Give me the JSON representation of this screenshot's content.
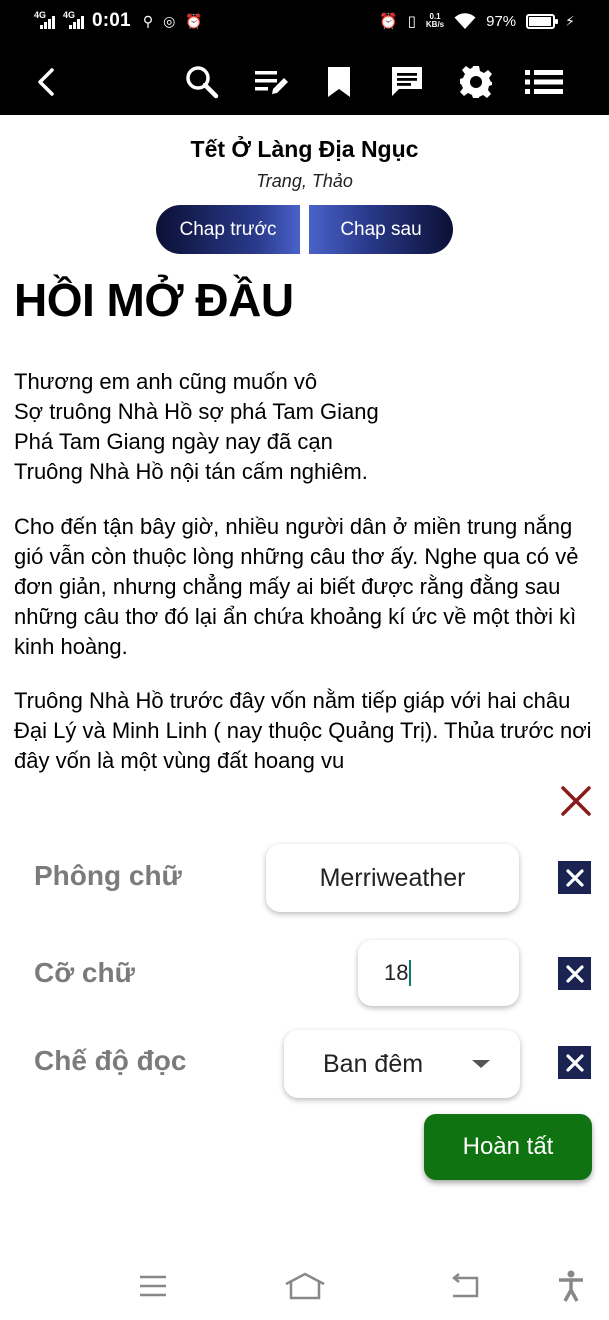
{
  "status_bar": {
    "network_1": "4G",
    "network_2": "4G",
    "time": "0:01",
    "speed_value": "0.1",
    "speed_unit": "KB/s",
    "battery": "97%",
    "battery_level": 0.97
  },
  "toolbar": {
    "icons": [
      "back-icon",
      "search-icon",
      "edit-list-icon",
      "bookmark-icon",
      "comment-icon",
      "gear-icon",
      "list-icon"
    ]
  },
  "book": {
    "title": "Tết Ở Làng Địa Ngục",
    "author": "Trang, Thảo",
    "prev_label": "Chap trước",
    "next_label": "Chap sau",
    "chapter_heading": "HỒI MỞ ĐẦU",
    "verse_lines": [
      "Thương em anh cũng muốn vô",
      "Sợ truông Nhà Hồ sợ phá Tam Giang",
      "Phá Tam Giang ngày nay đã cạn",
      "Truông Nhà Hồ nội tán cấm nghiêm."
    ],
    "paragraph_2": "Cho đến tận bây giờ, nhiều người dân ở miền trung nắng gió vẫn còn thuộc lòng những câu thơ ấy. Nghe qua có vẻ đơn giản, nhưng chẳng mấy ai biết được rằng đằng sau những câu thơ đó lại ẩn chứa khoảng kí ức về một thời kì kinh hoàng.",
    "paragraph_3": "Truông Nhà Hồ trước đây vốn nằm tiếp giáp với hai châu Đại Lý và Minh Linh ( nay thuộc Quảng Trị). Thủa trước nơi đây vốn là một vùng đất hoang vu"
  },
  "settings": {
    "font_label": "Phông chữ",
    "font_value": "Merriweather",
    "size_label": "Cỡ chữ",
    "size_value": "18",
    "mode_label": "Chế độ đọc",
    "mode_value": "Ban đêm",
    "done_label": "Hoàn tất"
  },
  "colors": {
    "done_button": "#0e7310",
    "close_icon": "#8b1a1a",
    "reset_button": "#1a2352",
    "chap_button_dark": "#0b1035",
    "chap_button_light": "#4a63c9"
  }
}
